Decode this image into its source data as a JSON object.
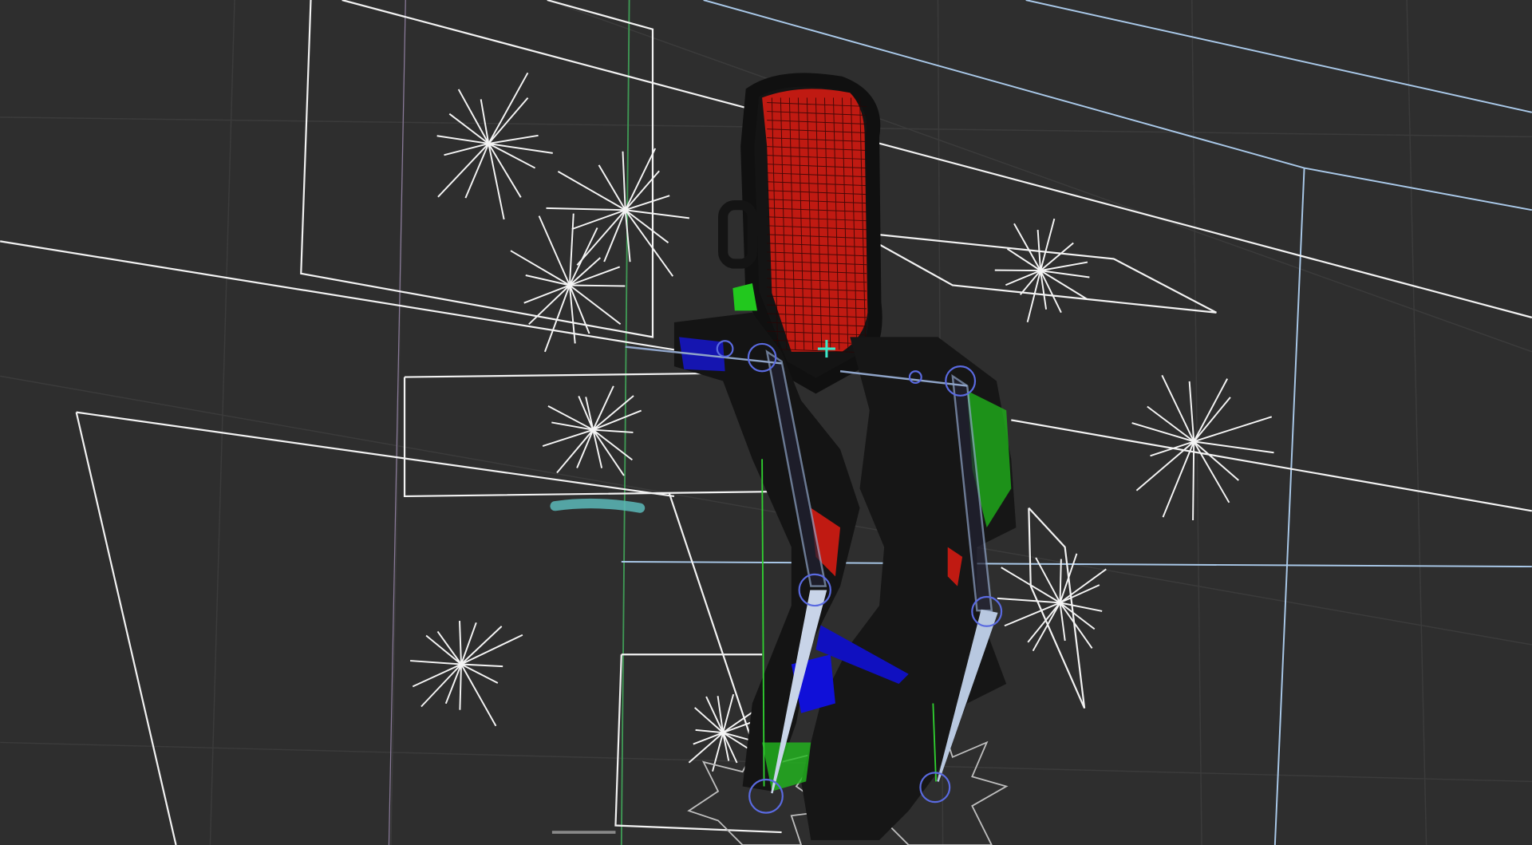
{
  "viewport": {
    "mode": "3d-viewport-wireframe",
    "colors": {
      "background": "#2e2e2e",
      "grid": "#3a3a3a",
      "lines_white": "#f2f2f2",
      "lines_blue": "#a9c8e8",
      "mesh_red": "#d01a10",
      "mesh_green": "#22c81e",
      "mesh_blue": "#1010d8",
      "body": "#141414",
      "bone": "#8fa4c8",
      "cursor": "#3ee8c8"
    },
    "icons": [
      "light-star-icon",
      "3d-cursor-icon"
    ]
  }
}
